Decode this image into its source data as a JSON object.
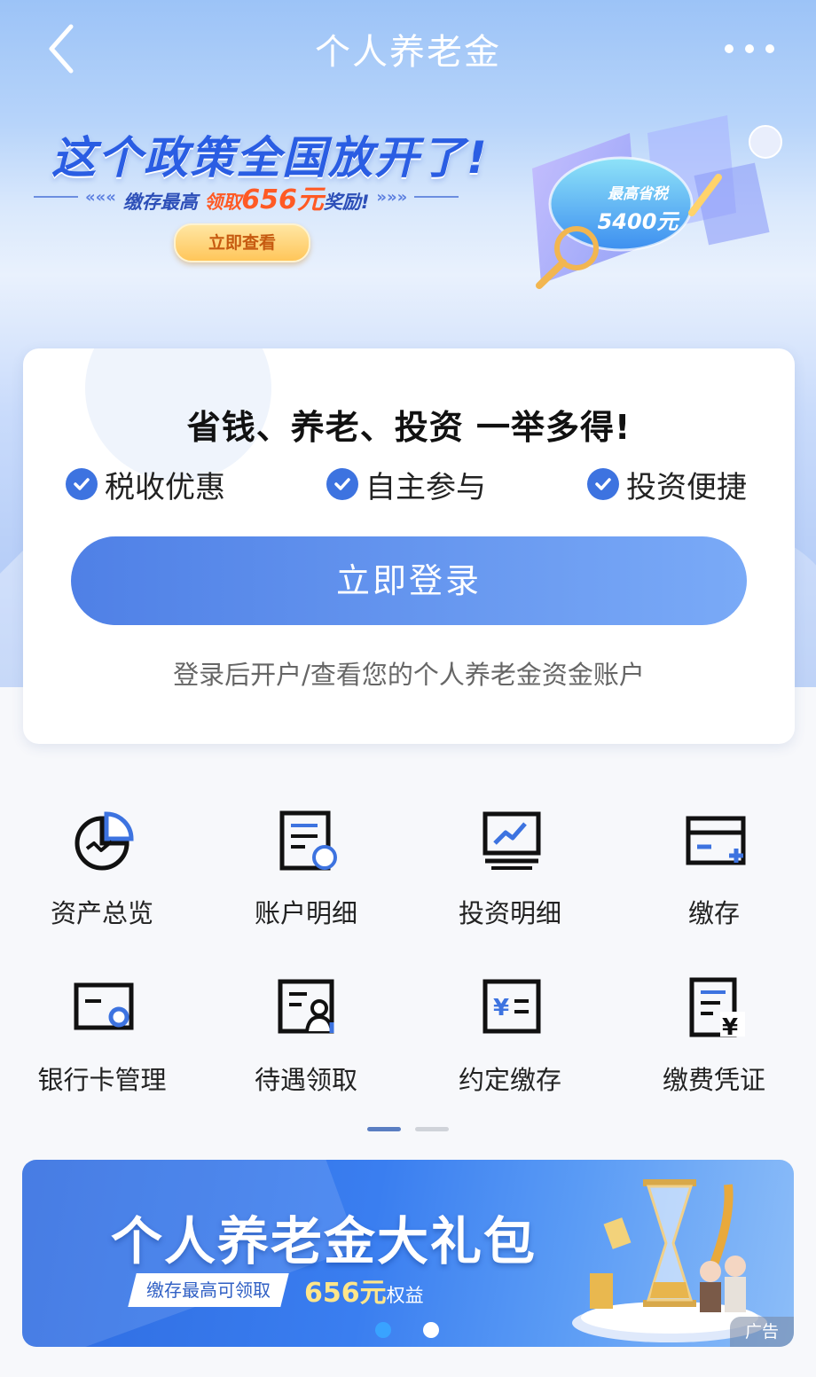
{
  "header": {
    "title": "个人养老金"
  },
  "banner": {
    "headline": "这个政策全国放开了!",
    "sub_prefix": "缴存最高",
    "sub_mid": "领取",
    "sub_amount": "656元",
    "sub_suffix": "奖励!",
    "button_label": "立即查看",
    "badge_line1": "最高省税",
    "badge_line2": "5400元"
  },
  "login_card": {
    "slogan": "省钱、养老、投资 一举多得!",
    "features": [
      "税收优惠",
      "自主参与",
      "投资便捷"
    ],
    "login_button": "立即登录",
    "hint": "登录后开户/查看您的个人养老金资金账户"
  },
  "services": [
    {
      "label": "资产总览",
      "icon": "asset-overview-icon"
    },
    {
      "label": "账户明细",
      "icon": "account-detail-icon"
    },
    {
      "label": "投资明细",
      "icon": "investment-detail-icon"
    },
    {
      "label": "缴存",
      "icon": "deposit-icon"
    },
    {
      "label": "银行卡管理",
      "icon": "bank-card-icon"
    },
    {
      "label": "待遇领取",
      "icon": "benefit-claim-icon"
    },
    {
      "label": "约定缴存",
      "icon": "scheduled-deposit-icon"
    },
    {
      "label": "缴费凭证",
      "icon": "payment-receipt-icon"
    }
  ],
  "pager": {
    "pages": 2,
    "current": 1
  },
  "ad": {
    "title": "个人养老金大礼包",
    "strip_text": "缴存最高可领取",
    "amount": "656元",
    "amount_suffix": "权益",
    "tag": "广告",
    "slides": 2,
    "current_slide": 1
  },
  "colors": {
    "accent": "#3d73e0",
    "highlight": "#ff5a25"
  }
}
